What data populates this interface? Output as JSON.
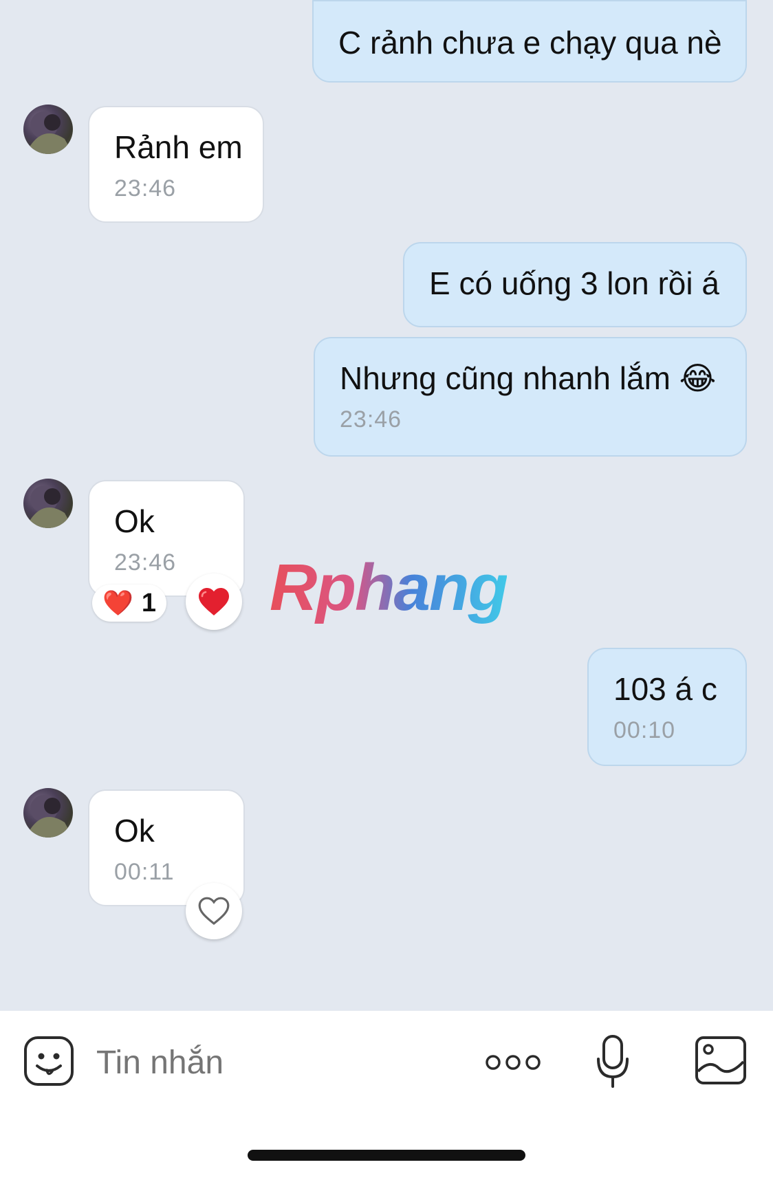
{
  "messages": [
    {
      "side": "me",
      "text": "C rảnh chưa e chạy qua nè"
    },
    {
      "side": "them",
      "text": "Rảnh em",
      "time": "23:46"
    },
    {
      "side": "me",
      "text": "E có uống 3 lon rồi á"
    },
    {
      "side": "me",
      "text": "Nhưng cũng nhanh lắm 😂",
      "time": "23:46"
    },
    {
      "side": "them",
      "text": "Ok",
      "time": "23:46",
      "reaction": "❤️",
      "reaction_count": "1"
    },
    {
      "side": "me",
      "text": "103 á c",
      "time": "00:10"
    },
    {
      "side": "them",
      "text": "Ok",
      "time": "00:11"
    }
  ],
  "watermark": "Rphang",
  "composer": {
    "placeholder": "Tin nhắn",
    "icons": [
      "emoji-icon",
      "more-icon",
      "microphone-icon",
      "image-icon"
    ]
  },
  "colors": {
    "background": "#e3e8f0",
    "my_bubble": "#d4e9fa",
    "their_bubble": "#ffffff",
    "time_text": "#9aa0a6"
  }
}
